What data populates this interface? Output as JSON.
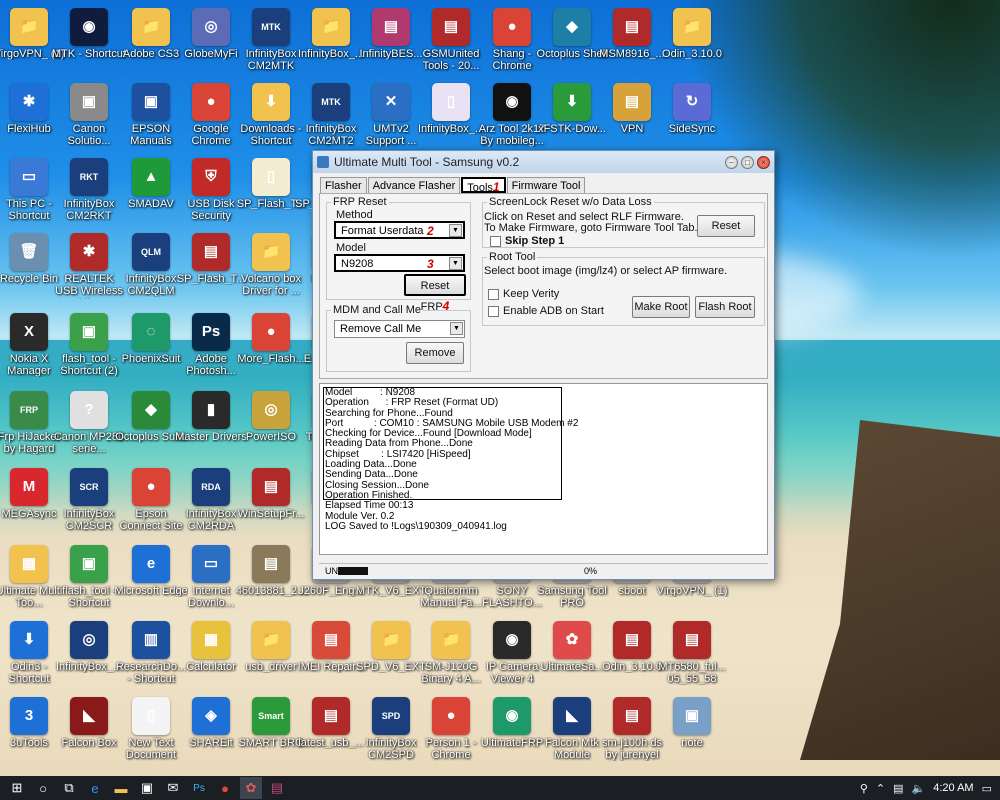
{
  "desktop_icons": [
    {
      "label": "VirgoVPN_ (1)",
      "glyph": "📁",
      "color": "#f2c24e"
    },
    {
      "label": "MTK - Shortcut",
      "glyph": "◉",
      "color": "#101c3d"
    },
    {
      "label": "Adobe CS3",
      "glyph": "📁",
      "color": "#f2c24e"
    },
    {
      "label": "GlobeMyFi",
      "glyph": "◎",
      "color": "#5b6bb6"
    },
    {
      "label": "InfinityBox CM2MTK",
      "glyph": "MTK",
      "color": "#1b3f7d"
    },
    {
      "label": "InfinityBox_...",
      "glyph": "📁",
      "color": "#f2c24e"
    },
    {
      "label": "InfinityBES...",
      "glyph": "▤",
      "color": "#b03a70"
    },
    {
      "label": "GSMUnited Tools - 20...",
      "glyph": "▤",
      "color": "#b02a2a"
    },
    {
      "label": "Shang - Chrome",
      "glyph": "●",
      "color": "#d94436"
    },
    {
      "label": "Octoplus Shell",
      "glyph": "◆",
      "color": "#1e7fa6"
    },
    {
      "label": "MSM8916_...",
      "glyph": "▤",
      "color": "#b02a2a"
    },
    {
      "label": "Odin_3.10.0",
      "glyph": "📁",
      "color": "#f2c24e"
    },
    {
      "label": "FlexiHub",
      "glyph": "✱",
      "color": "#1e6fd6"
    },
    {
      "label": "Canon Solutio...",
      "glyph": "▣",
      "color": "#8a8a8a"
    },
    {
      "label": "EPSON Manuals",
      "glyph": "▣",
      "color": "#1e50a0"
    },
    {
      "label": "Google Chrome",
      "glyph": "●",
      "color": "#d94436"
    },
    {
      "label": "Downloads - Shortcut",
      "glyph": "⬇",
      "color": "#f2c24e"
    },
    {
      "label": "InfinityBox CM2MT2",
      "glyph": "MTK",
      "color": "#1b3f7d"
    },
    {
      "label": "UMTv2 Support ...",
      "glyph": "✕",
      "color": "#2a6fc4"
    },
    {
      "label": "InfinityBox_...",
      "glyph": "▯",
      "color": "#e9e2f4"
    },
    {
      "label": "Arz Tool 2k17 By mobileg...",
      "glyph": "◉",
      "color": "#111"
    },
    {
      "label": "xFSTK-Dow...",
      "glyph": "⬇",
      "color": "#2a9a3a"
    },
    {
      "label": "VPN",
      "glyph": "▤",
      "color": "#d8a23a"
    },
    {
      "label": "SideSync",
      "glyph": "↻",
      "color": "#5b6bd6"
    },
    {
      "label": "This PC - Shortcut",
      "glyph": "▭",
      "color": "#3a7ad6"
    },
    {
      "label": "InfinityBox CM2RKT",
      "glyph": "RKT",
      "color": "#1b3f7d"
    },
    {
      "label": "SMADAV",
      "glyph": "▲",
      "color": "#1e9a3a"
    },
    {
      "label": "USB Disk Security",
      "glyph": "⛨",
      "color": "#c22a2a"
    },
    {
      "label": "SP_Flash_T...",
      "glyph": "▯",
      "color": "#f4ecd0"
    },
    {
      "label": "SP_Flash_Ti...",
      "glyph": "📁",
      "color": "#f2c24e"
    },
    {
      "label": "Recycle Bin",
      "glyph": "🗑",
      "color": "#6b8fb0"
    },
    {
      "label": "REALTEK USB Wireless LA...",
      "glyph": "✱",
      "color": "#b02a2a"
    },
    {
      "label": "InfinityBox CM2QLM",
      "glyph": "QLM",
      "color": "#1b3f7d"
    },
    {
      "label": "SP_Flash_T...",
      "glyph": "▤",
      "color": "#b02a2a"
    },
    {
      "label": "Volcano box Driver for ...",
      "glyph": "📁",
      "color": "#f2c24e"
    },
    {
      "label": "In... Al...",
      "glyph": "📁",
      "color": "#f2c24e"
    },
    {
      "label": "Nokia X Manager",
      "glyph": "X",
      "color": "#2a2a2a"
    },
    {
      "label": "flash_tool - Shortcut (2)",
      "glyph": "▣",
      "color": "#3aa04a"
    },
    {
      "label": "PhoenixSuit",
      "glyph": "◌",
      "color": "#1e9a6a"
    },
    {
      "label": "Adobe Photosh...",
      "glyph": "Ps",
      "color": "#0a2a4a"
    },
    {
      "label": "More_Flash...",
      "glyph": "●",
      "color": "#d94436"
    },
    {
      "label": "Ex... Cop...",
      "glyph": "▣",
      "color": "#1e6fd6"
    },
    {
      "label": "Frp HiJacker by Hagard",
      "glyph": "FRP",
      "color": "#3a8a4a"
    },
    {
      "label": "Canon MP280 serie...",
      "glyph": "?",
      "color": "#e0e0e0"
    },
    {
      "label": "Octoplus Suite",
      "glyph": "◆",
      "color": "#2a8a3a"
    },
    {
      "label": "Master Drivers",
      "glyph": "▮",
      "color": "#2a2a2a"
    },
    {
      "label": "PowerISO",
      "glyph": "◎",
      "color": "#c8a23a"
    },
    {
      "label": "To... Bro...",
      "glyph": "▣",
      "color": "#555"
    },
    {
      "label": "MEGAsync",
      "glyph": "M",
      "color": "#d9272e"
    },
    {
      "label": "InfinityBox CM2SCR",
      "glyph": "SCR",
      "color": "#1b3f7d"
    },
    {
      "label": "Epson Connect Site",
      "glyph": "●",
      "color": "#d94436"
    },
    {
      "label": "InfinityBox CM2RDA",
      "glyph": "RDA",
      "color": "#1b3f7d"
    },
    {
      "label": "WinSetupFr...",
      "glyph": "▤",
      "color": "#b02a2a"
    },
    {
      "label": "Gs...",
      "glyph": "▣",
      "color": "#333"
    },
    {
      "label": "Ultimate Multi Too...",
      "glyph": "▦",
      "color": "#f2c24e"
    },
    {
      "label": "flash_tool - Shortcut",
      "glyph": "▣",
      "color": "#3aa04a"
    },
    {
      "label": "Microsoft Edge",
      "glyph": "e",
      "color": "#1e6fd6"
    },
    {
      "label": "Internet Downlo...",
      "glyph": "▭",
      "color": "#2a6fc4"
    },
    {
      "label": "46013881_2...",
      "glyph": "▤",
      "color": "#8a7a5a"
    },
    {
      "label": "J260F_Eng...",
      "glyph": "▣",
      "color": "#b8b8b8"
    },
    {
      "label": "MTK_V6_EXT",
      "glyph": "▣",
      "color": "#b8b8b8"
    },
    {
      "label": "Qualcomm Manual Fa...",
      "glyph": "▣",
      "color": "#b8b8b8"
    },
    {
      "label": "SONY FLASHTO...",
      "glyph": "▣",
      "color": "#b8b8b8"
    },
    {
      "label": "Samsung Tool PRO",
      "glyph": "▣",
      "color": "#b8b8b8"
    },
    {
      "label": "sboot",
      "glyph": "▣",
      "color": "#b8b8b8"
    },
    {
      "label": "VirgoVPN_ (1)",
      "glyph": "▣",
      "color": "#b8b8b8"
    },
    {
      "label": "Odin3 - Shortcut",
      "glyph": "⬇",
      "color": "#1e6fd6"
    },
    {
      "label": "InfinityBox_...",
      "glyph": "◎",
      "color": "#1b3f7d"
    },
    {
      "label": "ResearchDo... - Shortcut",
      "glyph": "▥",
      "color": "#1e50a0"
    },
    {
      "label": "Calculator",
      "glyph": "▦",
      "color": "#e8c23a"
    },
    {
      "label": "usb_driver",
      "glyph": "📁",
      "color": "#f2c24e"
    },
    {
      "label": "IMEI Repair...",
      "glyph": "▤",
      "color": "#d84a3a"
    },
    {
      "label": "SPD_V6_EXT",
      "glyph": "📁",
      "color": "#f2c24e"
    },
    {
      "label": "SM-J120G Binary 4 A...",
      "glyph": "📁",
      "color": "#f2c24e"
    },
    {
      "label": "IP Camera Viewer 4",
      "glyph": "◉",
      "color": "#2a2a2a"
    },
    {
      "label": "UltimateSa...",
      "glyph": "✿",
      "color": "#e04a4a"
    },
    {
      "label": "Odin_3.10.0",
      "glyph": "▤",
      "color": "#b02a2a"
    },
    {
      "label": "MT6580_ful... 05_55_58",
      "glyph": "▤",
      "color": "#b02a2a"
    },
    {
      "label": "3uTools",
      "glyph": "3",
      "color": "#1e6fd6"
    },
    {
      "label": "Falcon Box",
      "glyph": "◣",
      "color": "#8a1a1a"
    },
    {
      "label": "New Text Document",
      "glyph": "▯",
      "color": "#f4f4f4"
    },
    {
      "label": "SHAREit",
      "glyph": "◈",
      "color": "#1e6fd6"
    },
    {
      "label": "SMART BRO",
      "glyph": "Smart",
      "color": "#2a9a3a"
    },
    {
      "label": "latest_usb_...",
      "glyph": "▤",
      "color": "#b02a2a"
    },
    {
      "label": "InfinityBox CM2SPD",
      "glyph": "SPD",
      "color": "#1b3f7d"
    },
    {
      "label": "Person 1 - Chrome",
      "glyph": "●",
      "color": "#d94436"
    },
    {
      "label": "UltimateFRP",
      "glyph": "◉",
      "color": "#1e9a6a"
    },
    {
      "label": "Falcon Mtk Module",
      "glyph": "◣",
      "color": "#1b3f7d"
    },
    {
      "label": "sm-j100h ds by jurenyel",
      "glyph": "▤",
      "color": "#b02a2a"
    },
    {
      "label": "note",
      "glyph": "▣",
      "color": "#7aa0c8"
    }
  ],
  "window": {
    "title": "Ultimate Multi Tool - Samsung v0.2",
    "tabs": [
      "Flasher",
      "Advance Flasher",
      "Tools",
      "Firmware Tool"
    ],
    "tools_badge": "1",
    "frp": {
      "legend": "FRP Reset",
      "method_label": "Method",
      "method_value": "Format Userdata",
      "method_badge": "2",
      "model_label": "Model",
      "model_value": "N9208",
      "model_badge": "3",
      "reset_label": "Reset FRP",
      "reset_badge": "4"
    },
    "mdm": {
      "legend": "MDM and Call Me",
      "select_value": "Remove Call Me",
      "remove_label": "Remove"
    },
    "screenlock": {
      "legend": "ScreenLock Reset w/o Data Loss",
      "line1": "Click on Reset and select RLF Firmware.",
      "line2": "To Make Firmware, goto Firmware Tool Tab.",
      "reset_label": "Reset",
      "skip_label": "Skip Step 1"
    },
    "root": {
      "legend": "Root Tool",
      "desc": "Select boot image (img/lz4) or select AP firmware.",
      "keep_verity": "Keep Verity",
      "enable_adb": "Enable ADB on Start",
      "make_root": "Make Root",
      "flash_root": "Flash Root"
    },
    "log_boxed": [
      "Model          : N9208",
      "Operation      : FRP Reset (Format UD)",
      "Searching for Phone...Found",
      "Port           : COM10 : SAMSUNG Mobile USB Modem #2",
      "Checking for Device...Found [Download Mode]",
      "Reading Data from Phone...Done",
      "Chipset        : LSI7420 [HiSpeed]",
      "Loading Data...Done",
      "Sending Data...Done",
      "Closing Session...Done",
      "Operation Finished."
    ],
    "log_after": [
      "Elapsed Time 00:13",
      "Module Ver. 0.2",
      "LOG Saved to !Logs\\190309_040941.log"
    ],
    "status_left": "UN",
    "status_progress": "0%"
  },
  "taskbar": {
    "time": "4:20 AM",
    "apps": [
      "windows-logo",
      "cortana",
      "task-view",
      "edge",
      "file-explorer",
      "store",
      "mail",
      "photoshop",
      "chrome",
      "umt",
      "winrar"
    ]
  }
}
